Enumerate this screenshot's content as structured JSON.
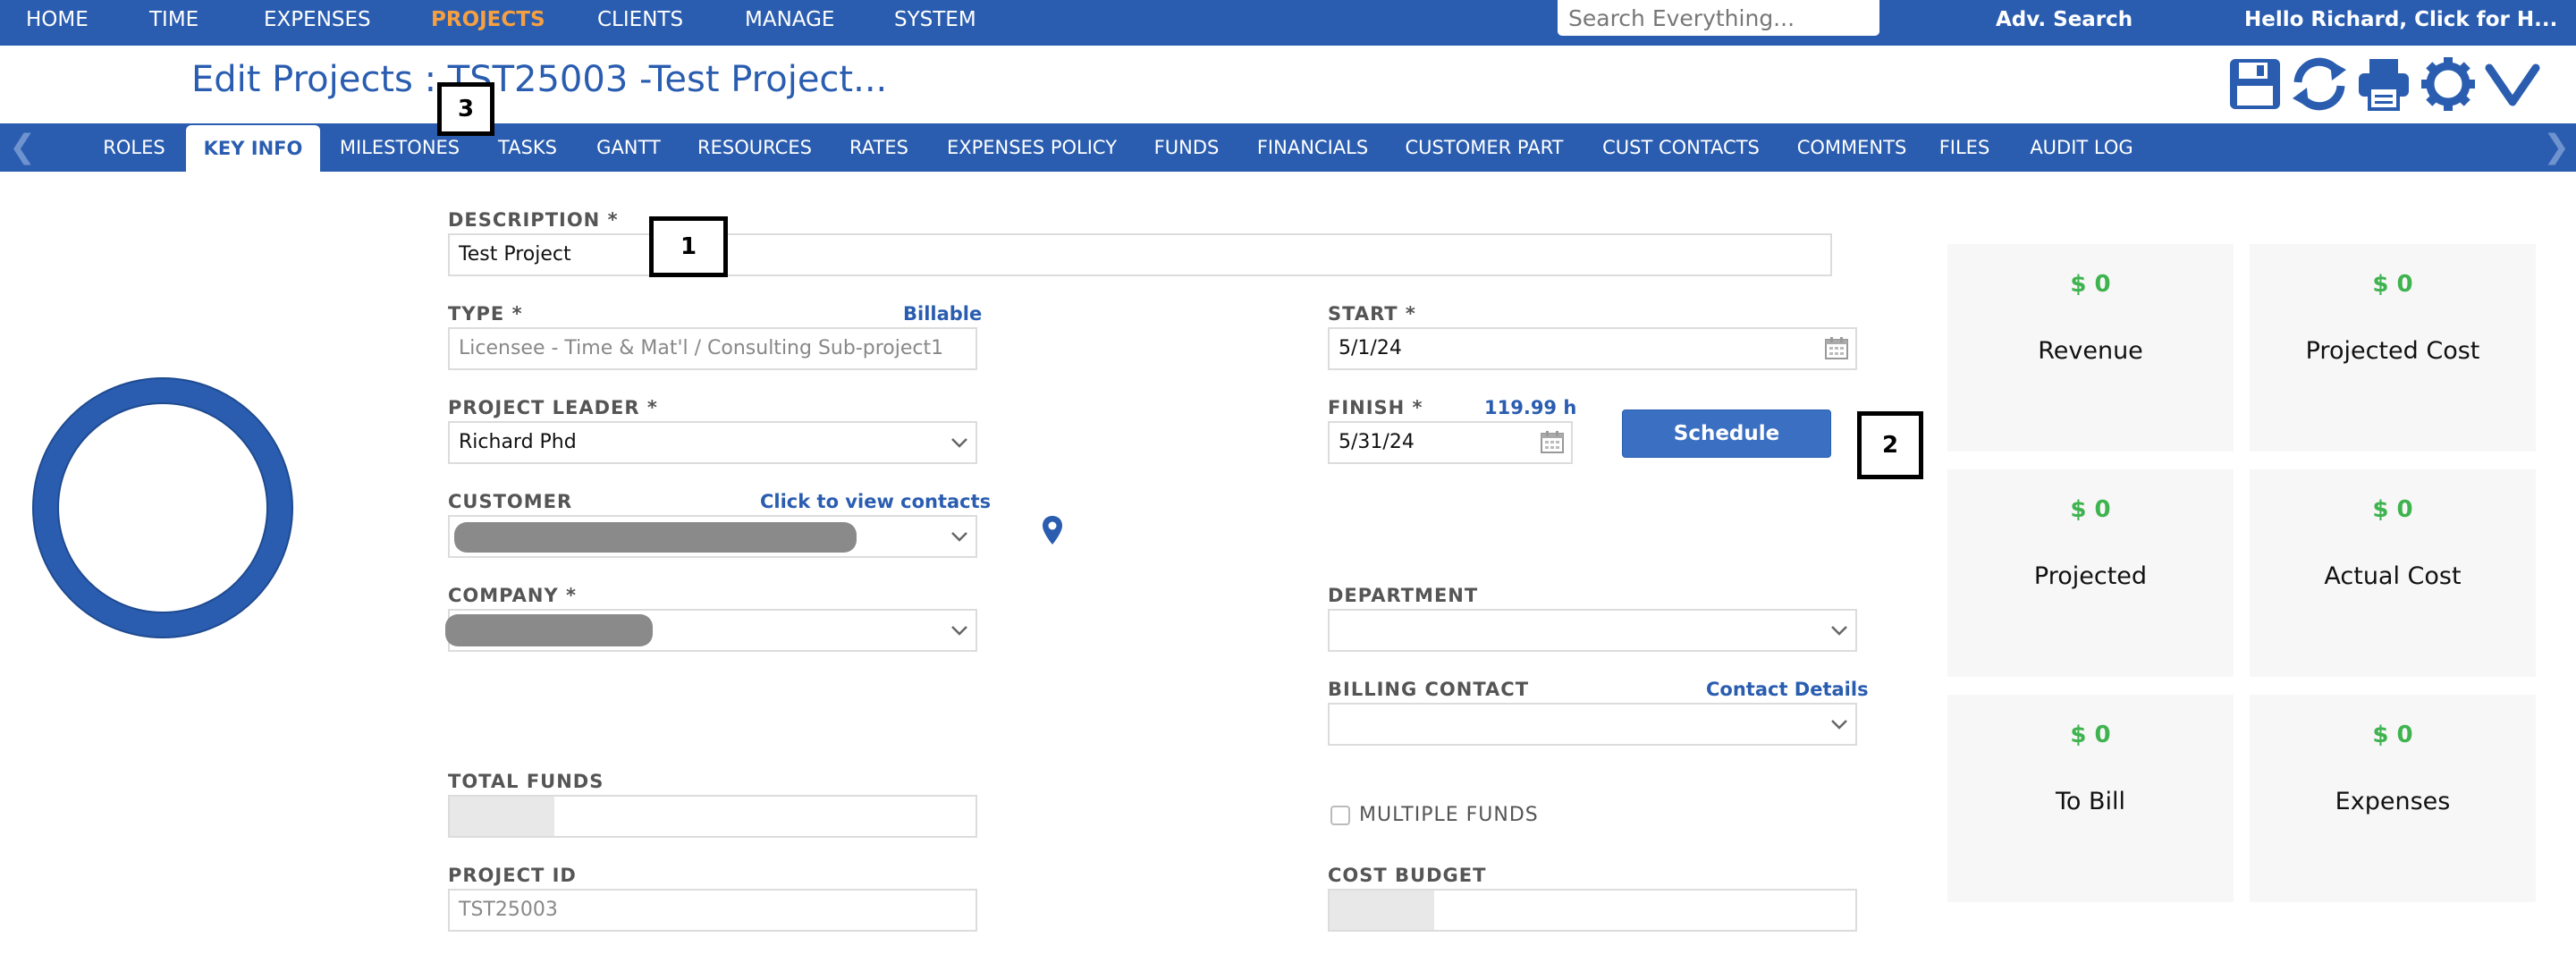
{
  "topnav": {
    "items": [
      "HOME",
      "TIME",
      "EXPENSES",
      "PROJECTS",
      "CLIENTS",
      "MANAGE",
      "SYSTEM"
    ],
    "active": "PROJECTS",
    "search_placeholder": "Search Everything...",
    "adv_search": "Adv. Search",
    "greeting": "Hello Richard, Click for H..."
  },
  "header": {
    "title": "Edit Projects : TST25003 -Test Project...",
    "toolbar_icons": [
      "save-icon",
      "refresh-icon",
      "print-icon",
      "settings-gear-icon",
      "collapse-chevron-icon"
    ]
  },
  "tabs": {
    "items": [
      "ROLES",
      "KEY INFO",
      "MILESTONES",
      "TASKS",
      "GANTT",
      "RESOURCES",
      "RATES",
      "EXPENSES POLICY",
      "FUNDS",
      "FINANCIALS",
      "CUSTOMER PART",
      "CUST CONTACTS",
      "COMMENTS",
      "FILES",
      "AUDIT LOG"
    ],
    "active": "KEY INFO",
    "left_arrow": "❮",
    "right_arrow": "❯"
  },
  "form": {
    "description": {
      "label": "DESCRIPTION *",
      "value": "Test Project"
    },
    "type": {
      "label": "TYPE *",
      "link": "Billable",
      "value": "Licensee - Time & Mat'l / Consulting Sub-project1"
    },
    "start": {
      "label": "START *",
      "value": "5/1/24"
    },
    "project_leader": {
      "label": "PROJECT LEADER *",
      "value": "Richard Phd"
    },
    "finish": {
      "label": "FINISH *",
      "hours": "119.99 h",
      "value": "5/31/24"
    },
    "schedule_button": "Schedule",
    "customer": {
      "label": "CUSTOMER",
      "link": "Click to view contacts"
    },
    "company": {
      "label": "COMPANY *"
    },
    "department": {
      "label": "DEPARTMENT",
      "value": ""
    },
    "billing_contact": {
      "label": "BILLING CONTACT",
      "link": "Contact Details",
      "value": ""
    },
    "total_funds": {
      "label": "TOTAL FUNDS"
    },
    "multiple_funds": {
      "label": "MULTIPLE FUNDS",
      "checked": false
    },
    "project_id": {
      "label": "PROJECT ID",
      "value": "TST25003"
    },
    "cost_budget": {
      "label": "COST BUDGET"
    }
  },
  "annotations": [
    "1",
    "2",
    "3"
  ],
  "cards": [
    {
      "amount": "$ 0",
      "caption": "Revenue"
    },
    {
      "amount": "$ 0",
      "caption": "Projected Cost"
    },
    {
      "amount": "$ 0",
      "caption": "Projected"
    },
    {
      "amount": "$ 0",
      "caption": "Actual Cost"
    },
    {
      "amount": "$ 0",
      "caption": "To Bill"
    },
    {
      "amount": "$ 0",
      "caption": "Expenses"
    }
  ],
  "colors": {
    "brand_blue": "#2a5db0",
    "active_nav": "#f6a040",
    "amount_green": "#3fb34f"
  }
}
